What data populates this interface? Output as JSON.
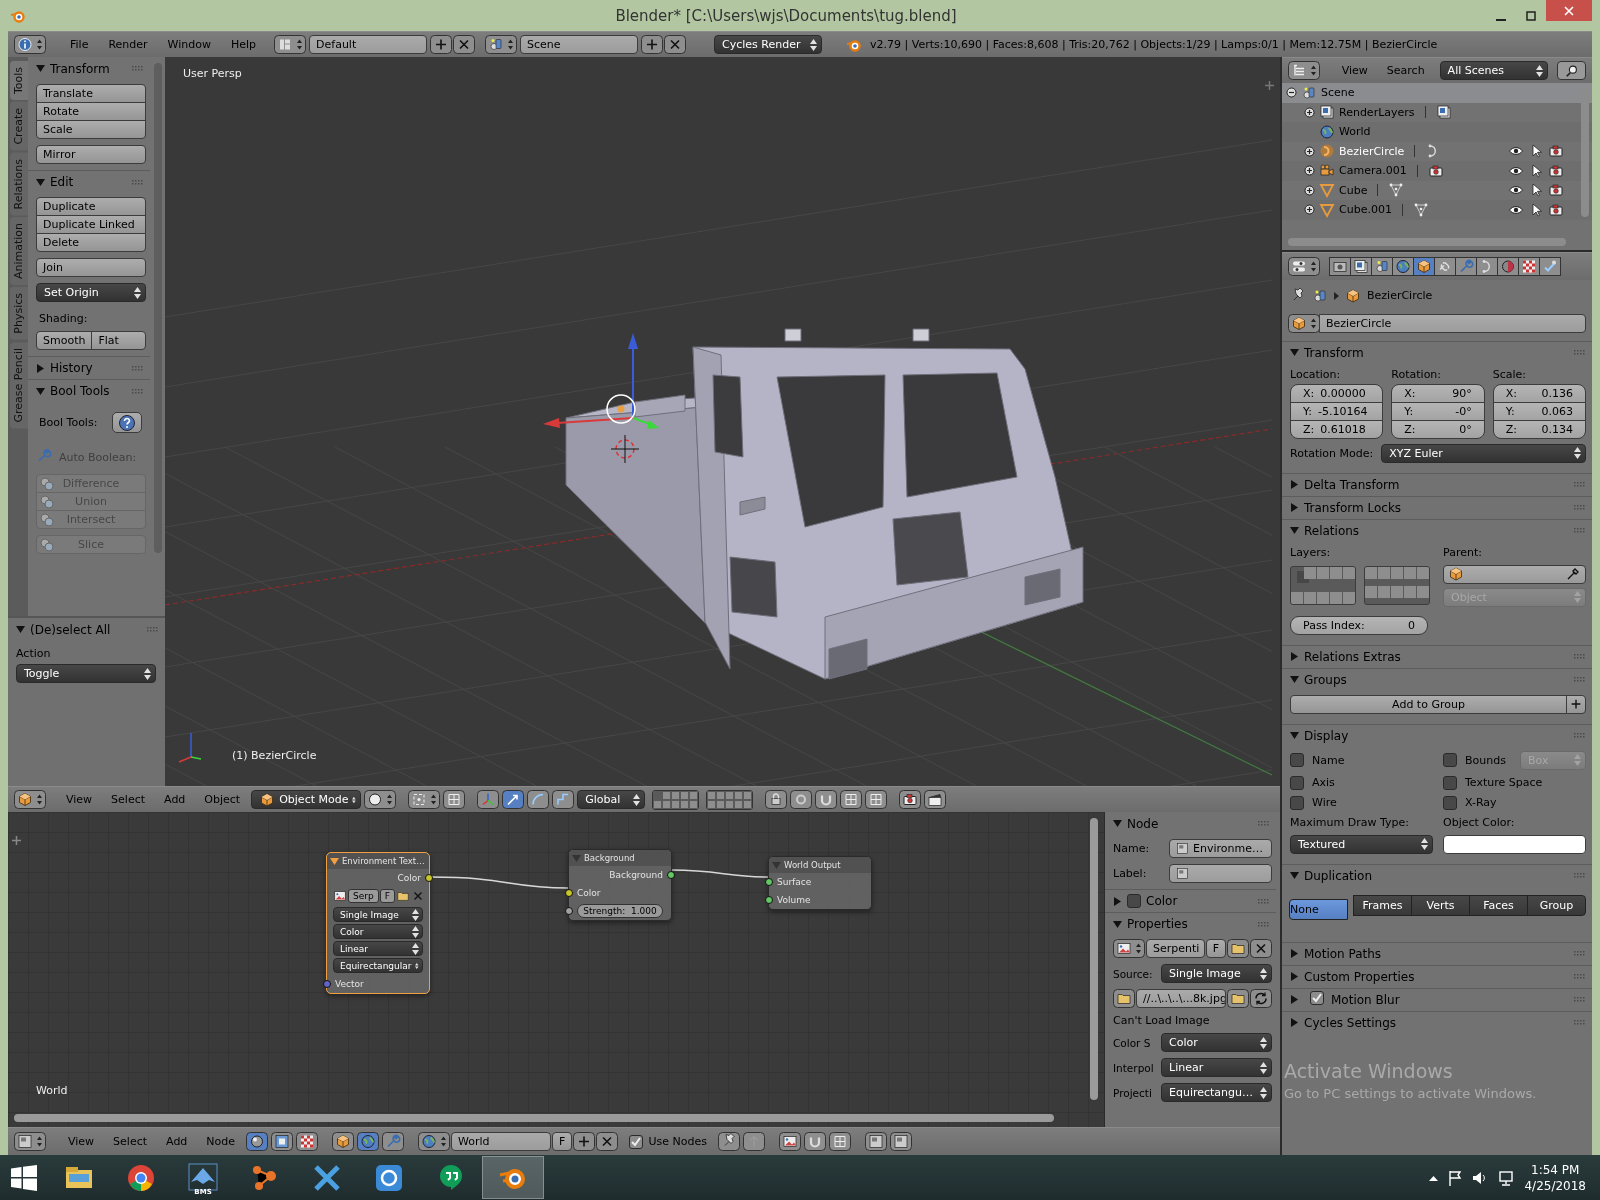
{
  "window": {
    "title": "Blender* [C:\\Users\\wjs\\Documents\\tug.blend]"
  },
  "info_header": {
    "menus": [
      "File",
      "Render",
      "Window",
      "Help"
    ],
    "layout": "Default",
    "scene": "Scene",
    "render_engine": "Cycles Render",
    "stats": "v2.79 | Verts:10,690 | Faces:8,608 | Tris:20,762 | Objects:1/29 | Lamps:0/1 | Mem:12.75M | BezierCircle"
  },
  "tool_shelf": {
    "tabs": [
      {
        "label": "Tools",
        "selected": true
      },
      {
        "label": "Create",
        "selected": false
      },
      {
        "label": "Relations",
        "selected": false
      },
      {
        "label": "Animation",
        "selected": false
      },
      {
        "label": "Physics",
        "selected": false
      },
      {
        "label": "Grease Pencil",
        "selected": false
      }
    ],
    "panels": [
      {
        "title": "Transform",
        "expanded": true,
        "items": [
          {
            "kind": "buttons",
            "labels": [
              "Translate",
              "Rotate",
              "Scale"
            ],
            "disabled": false
          },
          {
            "kind": "buttons",
            "labels": [
              "Mirror"
            ],
            "disabled": false
          }
        ]
      },
      {
        "title": "Edit",
        "expanded": true,
        "items": [
          {
            "kind": "buttons",
            "labels": [
              "Duplicate",
              "Duplicate Linked",
              "Delete"
            ],
            "disabled": false
          },
          {
            "kind": "buttons",
            "labels": [
              "Join"
            ],
            "disabled": false
          },
          {
            "kind": "dropdown",
            "value": "Set Origin",
            "disabled": false
          },
          {
            "kind": "label",
            "text": "Shading:",
            "disabled": false
          },
          {
            "kind": "row",
            "labels": [
              "Smooth",
              "Flat"
            ],
            "disabled": false
          }
        ]
      },
      {
        "title": "History",
        "expanded": false
      },
      {
        "title": "Bool Tools",
        "expanded": true,
        "items": [
          {
            "kind": "help",
            "text": "Bool Tools:",
            "disabled": false
          },
          {
            "kind": "wrench-label",
            "text": "Auto Boolean:",
            "disabled": true
          },
          {
            "kind": "bool-buttons",
            "labels": [
              "Difference",
              "Union",
              "Intersect"
            ],
            "disabled": true
          },
          {
            "kind": "bool-buttons",
            "labels": [
              "Slice"
            ],
            "disabled": true
          }
        ]
      }
    ],
    "operator": {
      "title": "(De)select All",
      "expanded": true,
      "label": "Action",
      "value": "Toggle"
    }
  },
  "viewport": {
    "view_label": "User Persp",
    "object_label": "(1) BezierCircle"
  },
  "view3d_header": {
    "menus": [
      "View",
      "Select",
      "Add",
      "Object"
    ],
    "mode": "Object Mode",
    "orientation": "Global",
    "layers": [
      true,
      false,
      false,
      false,
      false,
      false,
      false,
      false,
      false,
      false,
      false,
      false,
      false,
      false,
      false,
      false,
      false,
      false,
      false,
      false
    ]
  },
  "node_editor": {
    "nodes": [
      {
        "kind": "environment",
        "title": "Environment Text…",
        "selected": true,
        "outputs": [
          {
            "label": "Color",
            "color": "#c7c729"
          }
        ],
        "image": "Serp",
        "fake_user": "F",
        "dropdowns": [
          "Single Image",
          "Color",
          "Linear",
          "Equirectangular"
        ],
        "inputs": [
          {
            "label": "Vector",
            "color": "#6363c7"
          }
        ]
      },
      {
        "kind": "background",
        "title": "Background",
        "selected": false,
        "outputs": [
          {
            "label": "Background",
            "color": "#63c763"
          }
        ],
        "inputs": [
          {
            "label": "Color",
            "color": "#c7c729"
          }
        ],
        "strength": {
          "label": "Strength:",
          "value": "1.000",
          "color": "#a1a1a1"
        }
      },
      {
        "kind": "output",
        "title": "World Output",
        "selected": false,
        "inputs": [
          {
            "label": "Surface",
            "color": "#63c763"
          },
          {
            "label": "Volume",
            "color": "#63c763"
          }
        ]
      }
    ],
    "context_label": "World",
    "sidebar": {
      "node_panel": {
        "title": "Node",
        "expanded": true,
        "name_label": "Name:",
        "name": "Environme…",
        "label_label": "Label:"
      },
      "color_panel": {
        "title": "Color",
        "expanded": false,
        "checked": false
      },
      "properties_panel": {
        "title": "Properties",
        "expanded": true,
        "image": "Serpenti",
        "fake_user": "F",
        "source_label": "Source:",
        "source": "Single Image",
        "filepath": "//..\\..\\..\\...8k.jpg",
        "message": "Can't Load Image",
        "fields": [
          {
            "label": "Color S",
            "value": "Color"
          },
          {
            "label": "Interpol",
            "value": "Linear"
          },
          {
            "label": "Projecti",
            "value": "Equirectangu…"
          }
        ]
      }
    }
  },
  "node_header": {
    "menus": [
      "View",
      "Select",
      "Add",
      "Node"
    ],
    "world": "World",
    "fake_user": "F",
    "use_nodes": {
      "label": "Use Nodes",
      "checked": true
    }
  },
  "outliner": {
    "menus": [
      "View",
      "Search"
    ],
    "filter": "All Scenes",
    "tree": [
      {
        "name": "Scene",
        "kind": "scene",
        "expanded": true,
        "selected": true,
        "active": false,
        "children": [
          {
            "name": "RenderLayers",
            "kind": "renderlayers",
            "expanded": false,
            "selected": false,
            "active": false
          },
          {
            "name": "World",
            "kind": "world",
            "selected": false,
            "active": false
          },
          {
            "name": "BezierCircle",
            "kind": "curve",
            "expanded": false,
            "selected": false,
            "active": true
          },
          {
            "name": "Camera.001",
            "kind": "camera",
            "expanded": false,
            "selected": false,
            "active": false
          },
          {
            "name": "Cube",
            "kind": "mesh",
            "expanded": false,
            "selected": false,
            "active": false
          },
          {
            "name": "Cube.001",
            "kind": "mesh",
            "expanded": false,
            "selected": false,
            "active": false
          }
        ]
      }
    ]
  },
  "properties": {
    "tabs": [
      {
        "kind": "render",
        "selected": false
      },
      {
        "kind": "renderlayers",
        "selected": false
      },
      {
        "kind": "scene",
        "selected": false
      },
      {
        "kind": "world",
        "selected": false
      },
      {
        "kind": "object",
        "selected": true
      },
      {
        "kind": "constraints",
        "selected": false
      },
      {
        "kind": "modifiers",
        "selected": false
      },
      {
        "kind": "curve",
        "selected": false
      },
      {
        "kind": "material",
        "selected": false
      },
      {
        "kind": "texture",
        "selected": false
      },
      {
        "kind": "physics",
        "selected": false
      }
    ],
    "breadcrumb": "BezierCircle",
    "object_name": "BezierCircle",
    "panels": [
      {
        "kind": "transform",
        "title": "Transform",
        "expanded": true,
        "columns": [
          {
            "label": "Location:",
            "fields": [
              {
                "axis": "X:",
                "value": "0.00000"
              },
              {
                "axis": "Y:",
                "value": "-5.10164"
              },
              {
                "axis": "Z:",
                "value": "0.61018"
              }
            ]
          },
          {
            "label": "Rotation:",
            "fields": [
              {
                "axis": "X:",
                "value": "90°"
              },
              {
                "axis": "Y:",
                "value": "-0°"
              },
              {
                "axis": "Z:",
                "value": "0°"
              }
            ]
          },
          {
            "label": "Scale:",
            "fields": [
              {
                "axis": "X:",
                "value": "0.136"
              },
              {
                "axis": "Y:",
                "value": "0.063"
              },
              {
                "axis": "Z:",
                "value": "0.134"
              }
            ]
          }
        ],
        "mode_label": "Rotation Mode:",
        "mode": "XYZ Euler"
      },
      {
        "kind": "plain",
        "title": "Delta Transform",
        "expanded": false
      },
      {
        "kind": "plain",
        "title": "Transform Locks",
        "expanded": false
      },
      {
        "kind": "relations",
        "title": "Relations",
        "expanded": true,
        "layers_label": "Layers:",
        "layers": [
          true,
          false,
          false,
          false,
          false,
          false,
          false,
          false,
          false,
          false,
          false,
          false,
          false,
          false,
          false,
          false,
          false,
          false,
          false,
          false
        ],
        "parent_label": "Parent:",
        "parent_type": "Object",
        "pass_label": "Pass Index:",
        "pass_index": "0"
      },
      {
        "kind": "plain",
        "title": "Relations Extras",
        "expanded": false
      },
      {
        "kind": "groups",
        "title": "Groups",
        "expanded": true,
        "button": "Add to Group"
      },
      {
        "kind": "display",
        "title": "Display",
        "expanded": true,
        "checkboxes": [
          {
            "label": "Name",
            "checked": false
          },
          {
            "label": "Bounds",
            "checked": false
          },
          {
            "label": "Axis",
            "checked": false
          },
          {
            "label": "Texture Space",
            "checked": false
          },
          {
            "label": "Wire",
            "checked": false
          },
          {
            "label": "X-Ray",
            "checked": false
          }
        ],
        "bounds_type": "Box",
        "draw_label": "Maximum Draw Type:",
        "draw_type": "Textured",
        "color_label": "Object Color:"
      },
      {
        "kind": "duplication",
        "title": "Duplication",
        "expanded": true,
        "options": [
          {
            "label": "None",
            "selected": true
          },
          {
            "label": "Frames",
            "selected": false
          },
          {
            "label": "Verts",
            "selected": false
          },
          {
            "label": "Faces",
            "selected": false
          },
          {
            "label": "Group",
            "selected": false
          }
        ]
      },
      {
        "kind": "plain",
        "title": "Motion Paths",
        "expanded": false
      },
      {
        "kind": "plain",
        "title": "Custom Properties",
        "expanded": false
      },
      {
        "kind": "toggle",
        "title": "Motion Blur",
        "expanded": false,
        "checked": true
      },
      {
        "kind": "plain",
        "title": "Cycles Settings",
        "expanded": false
      }
    ]
  },
  "os_notice": {
    "title": "Activate Windows",
    "text": "Go to PC settings to activate Windows."
  },
  "taskbar": {
    "apps": [
      {
        "kind": "explorer",
        "selected": false
      },
      {
        "kind": "chrome",
        "selected": false
      },
      {
        "kind": "bms",
        "label": "BMS",
        "selected": false
      },
      {
        "kind": "graph",
        "selected": false
      },
      {
        "kind": "xapp",
        "selected": false
      },
      {
        "kind": "mail",
        "selected": false
      },
      {
        "kind": "hangouts",
        "selected": false
      },
      {
        "kind": "blender",
        "selected": true
      }
    ],
    "time": "1:54 PM",
    "date": "4/25/2018"
  }
}
